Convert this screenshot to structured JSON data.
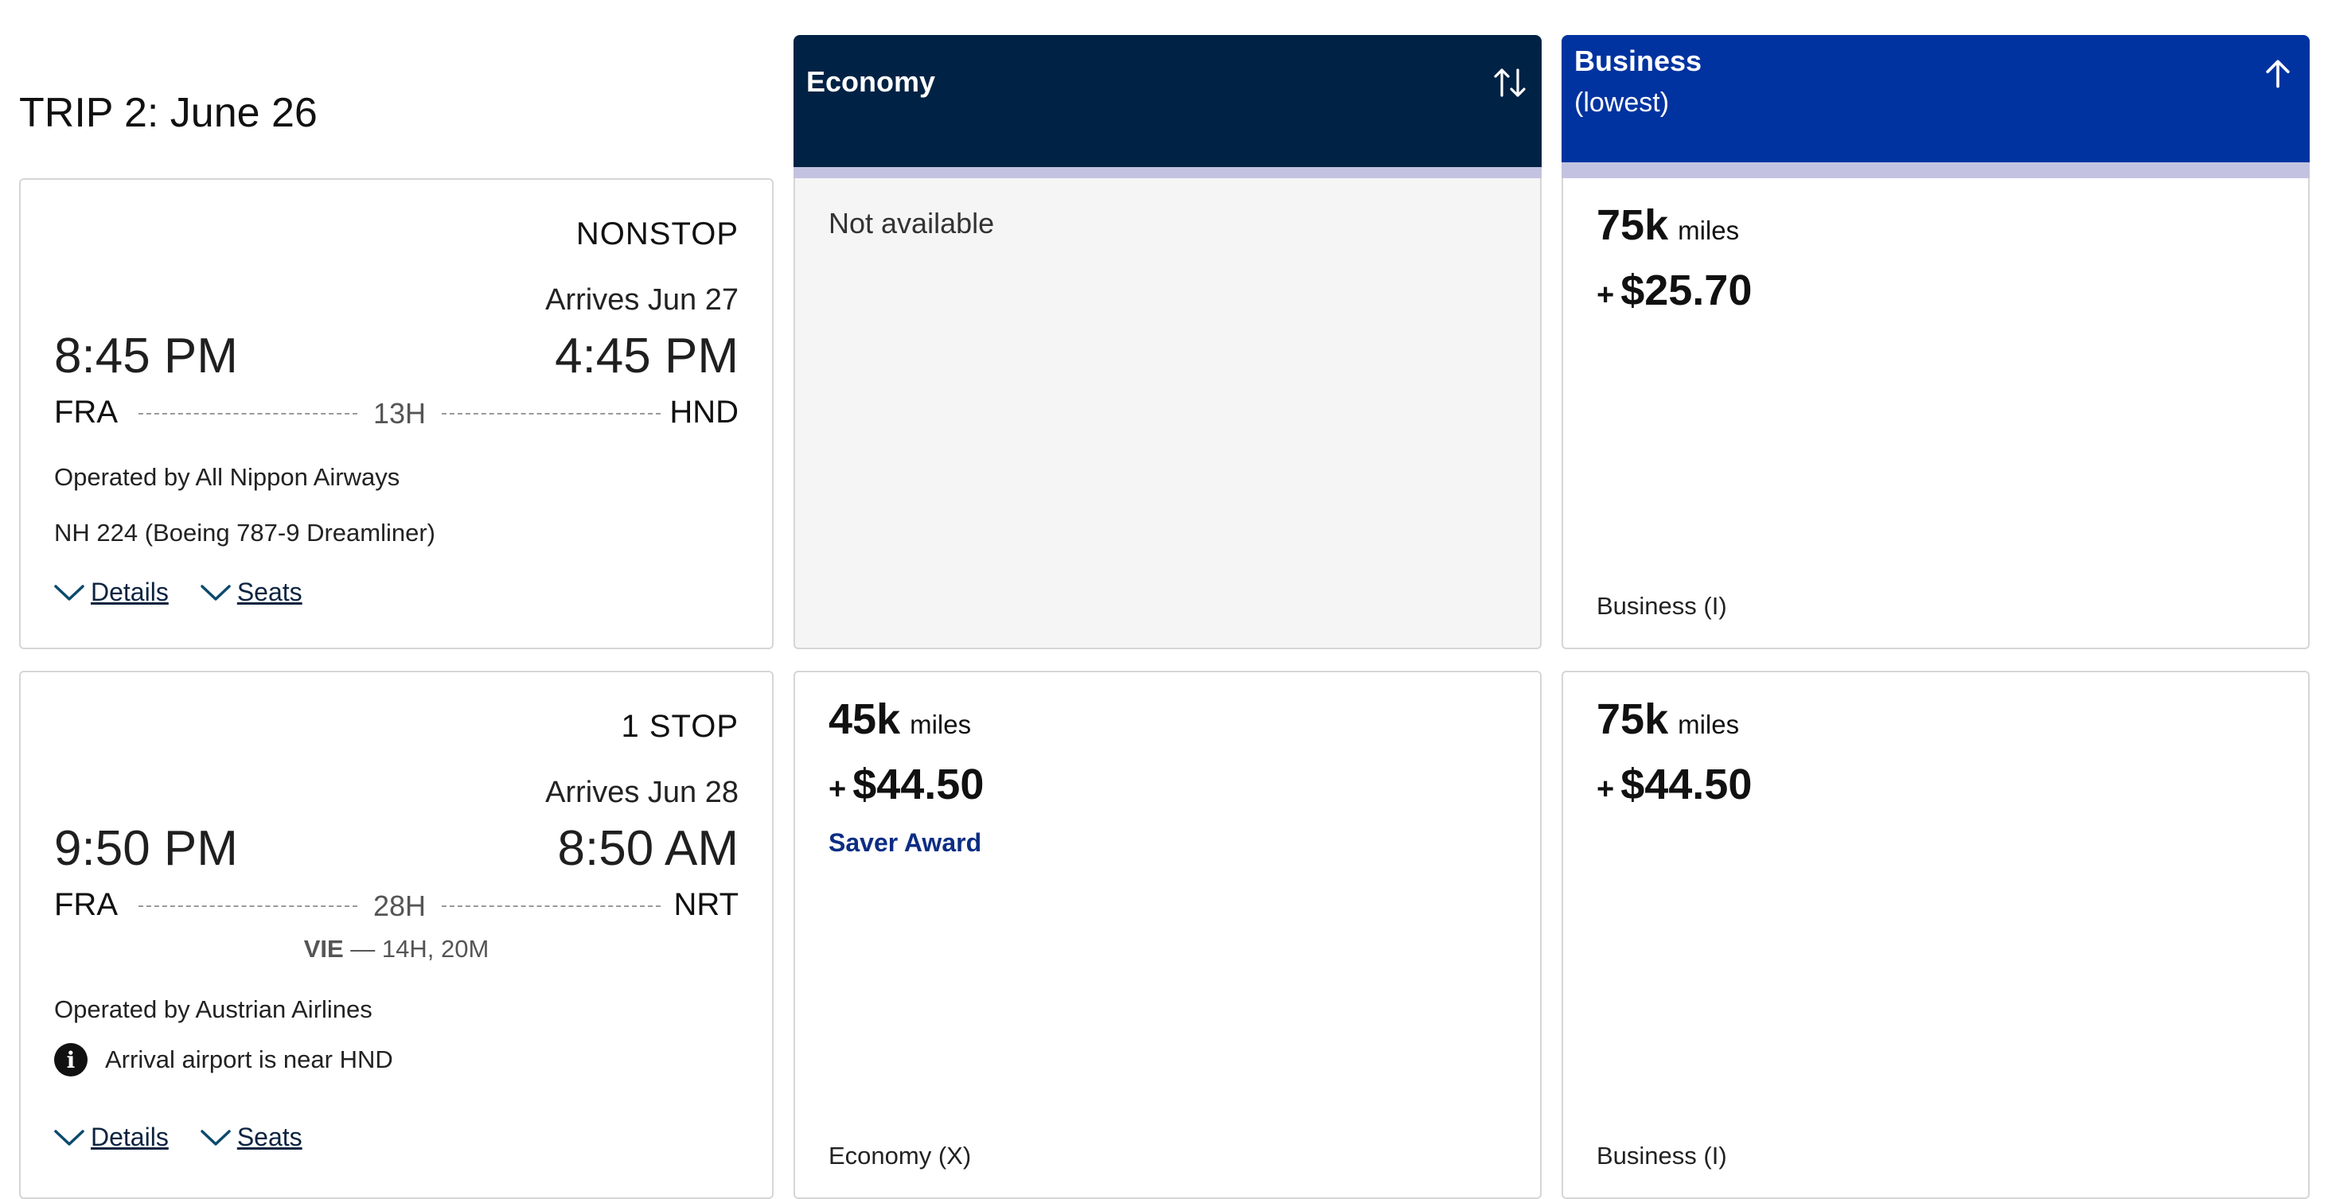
{
  "trip": {
    "title": "TRIP 2: June 26"
  },
  "columns": {
    "economy": {
      "label": "Economy",
      "sort_icon": "sort-both-icon",
      "color": "#002244"
    },
    "business": {
      "label": "Business",
      "sublabel": "(lowest)",
      "sort_icon": "arrow-up-icon",
      "color": "#0033a0"
    },
    "band_color": "#c3c2e0"
  },
  "flights": [
    {
      "stops": "NONSTOP",
      "arrives": "Arrives Jun 27",
      "depart_time": "8:45 PM",
      "arrive_time": "4:45 PM",
      "origin": "FRA",
      "destination": "HND",
      "duration": "13H",
      "operator": "Operated by All Nippon Airways",
      "flight_number": "NH 224 (Boeing 787-9 Dreamliner)",
      "details_label": "Details",
      "seats_label": "Seats",
      "fares": {
        "economy": {
          "not_available": "Not available"
        },
        "business": {
          "miles": "75k",
          "miles_unit": "miles",
          "plus": "+",
          "fee": "$25.70",
          "fare_class": "Business (I)"
        }
      }
    },
    {
      "stops": "1 STOP",
      "arrives": "Arrives Jun 28",
      "depart_time": "9:50 PM",
      "arrive_time": "8:50 AM",
      "origin": "FRA",
      "destination": "NRT",
      "duration": "28H",
      "layover_airport": "VIE",
      "layover_sep": "—",
      "layover_time": "14H, 20M",
      "operator": "Operated by Austrian Airlines",
      "notice": "Arrival airport is near HND",
      "details_label": "Details",
      "seats_label": "Seats",
      "fares": {
        "economy": {
          "miles": "45k",
          "miles_unit": "miles",
          "plus": "+",
          "fee": "$44.50",
          "tag": "Saver Award",
          "fare_class": "Economy (X)"
        },
        "business": {
          "miles": "75k",
          "miles_unit": "miles",
          "plus": "+",
          "fee": "$44.50",
          "fare_class": "Business (I)"
        }
      }
    }
  ]
}
